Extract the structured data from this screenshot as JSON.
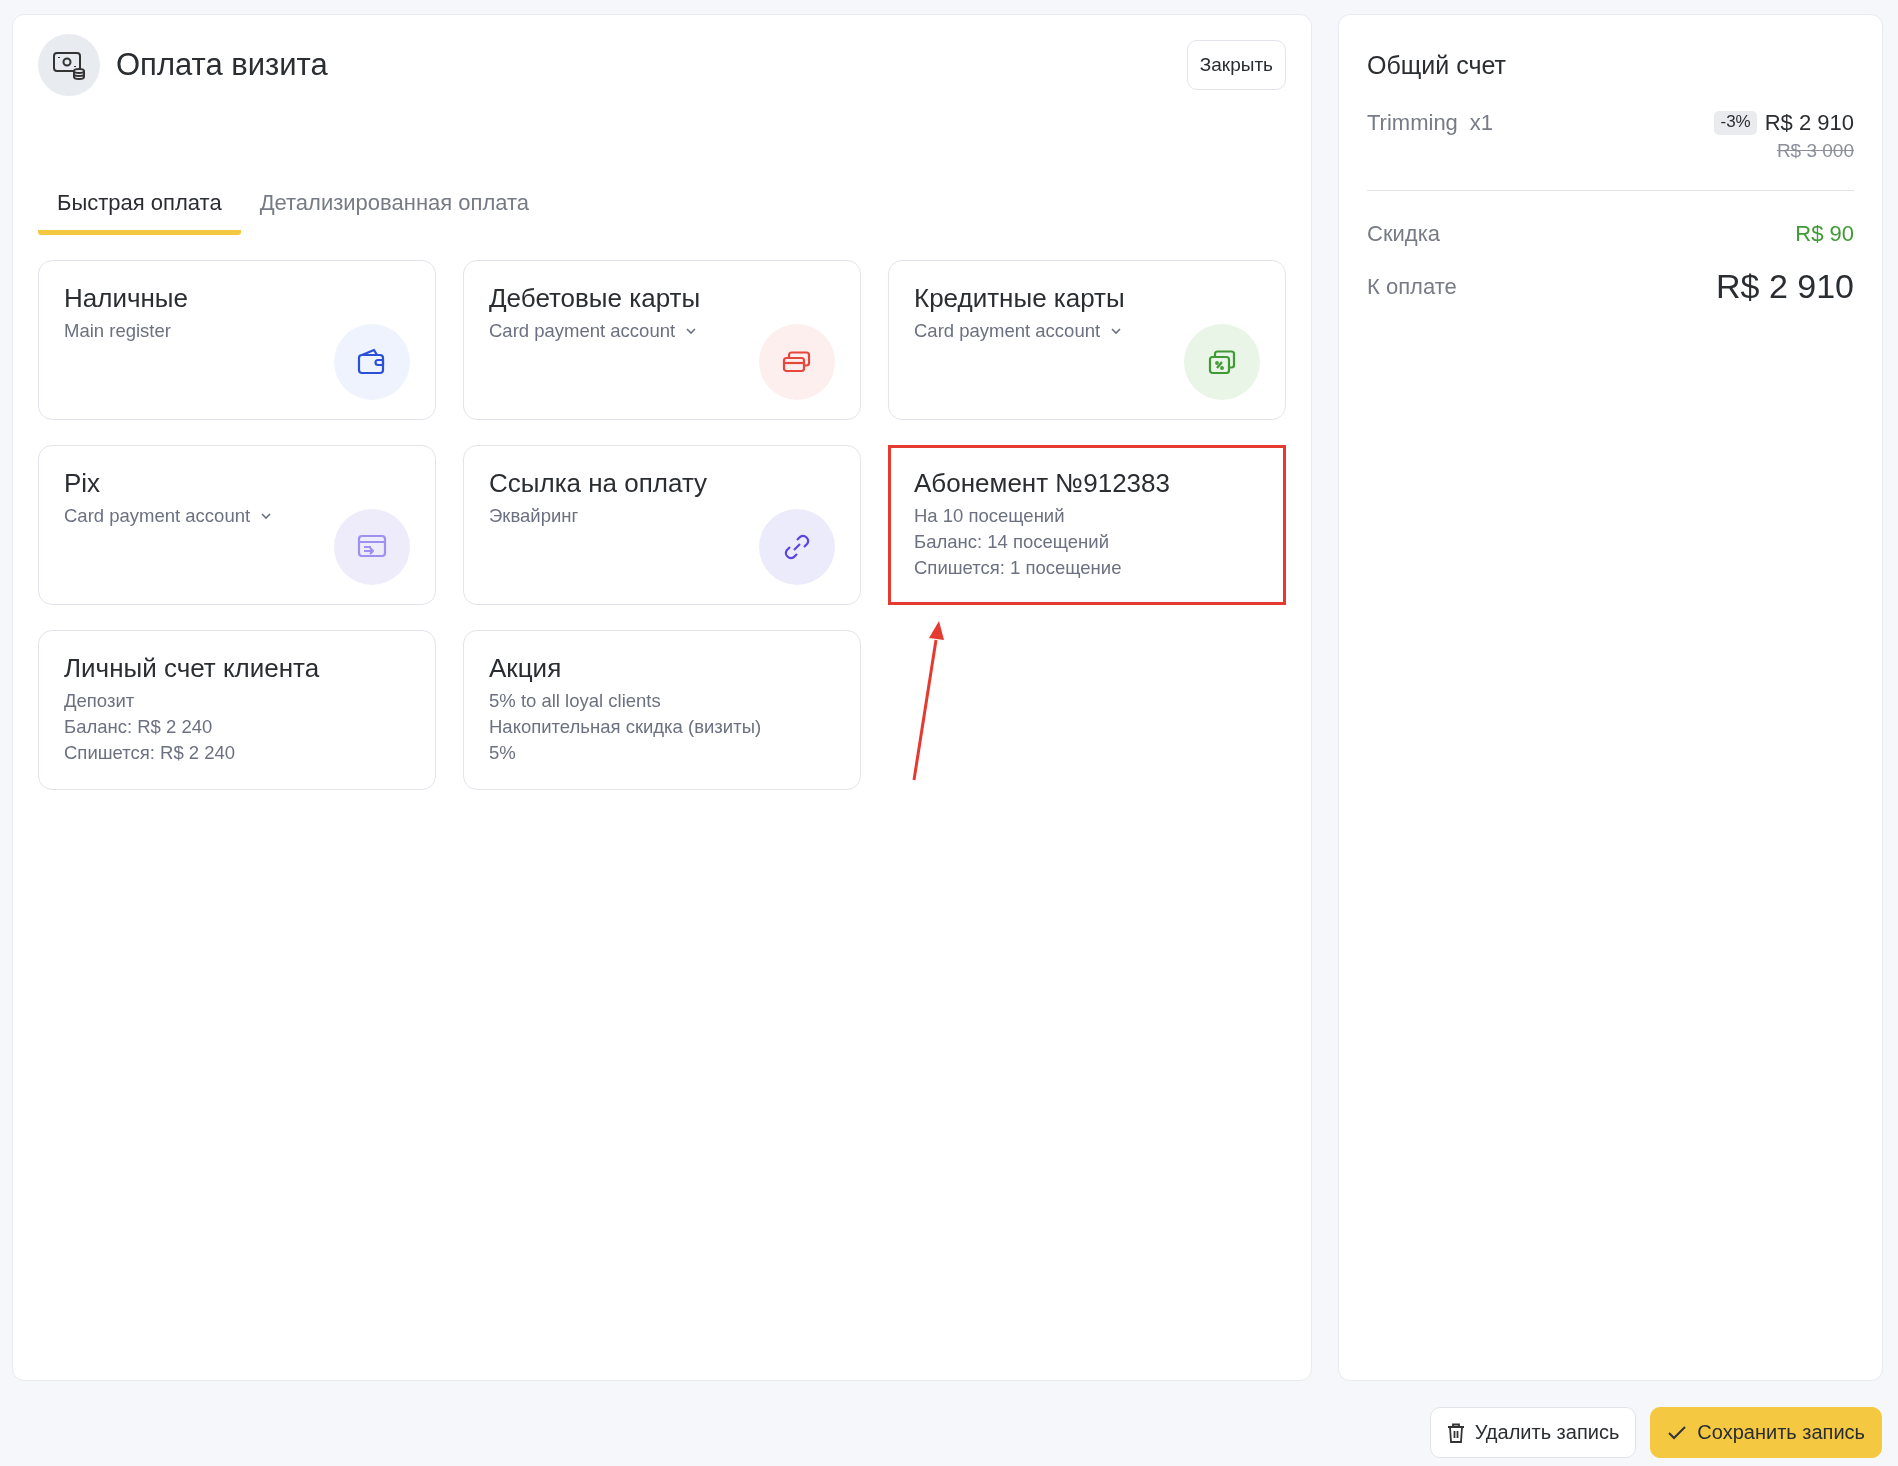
{
  "header": {
    "title": "Оплата визита",
    "close_button": "Закрыть"
  },
  "tabs": [
    {
      "label": "Быстрая оплата",
      "selected": true
    },
    {
      "label": "Детализированная оплата",
      "selected": false
    }
  ],
  "payment_methods": [
    {
      "title": "Наличные",
      "lines": [
        "Main register"
      ],
      "dropdown": false,
      "kind": "wallet",
      "highlighted": false
    },
    {
      "title": "Дебетовые карты",
      "lines": [
        "Card payment account"
      ],
      "dropdown": true,
      "kind": "cards",
      "highlighted": false
    },
    {
      "title": "Кредитные карты",
      "lines": [
        "Card payment account"
      ],
      "dropdown": true,
      "kind": "cards-percent",
      "highlighted": false
    },
    {
      "title": "Pix",
      "lines": [
        "Card payment account"
      ],
      "dropdown": true,
      "kind": "transfer",
      "highlighted": false
    },
    {
      "title": "Ссылка на оплату",
      "lines": [
        "Эквайринг"
      ],
      "dropdown": false,
      "kind": "link",
      "highlighted": false
    },
    {
      "title": "Абонемент №912383",
      "lines": [
        "На 10 посещений",
        "Баланс: 14 посещений",
        "Спишется: 1 посещение"
      ],
      "dropdown": false,
      "kind": "text",
      "highlighted": true
    },
    {
      "title": "Личный счет клиента",
      "lines": [
        "Депозит",
        "Баланс: R$ 2 240",
        "Спишется: R$ 2 240"
      ],
      "dropdown": false,
      "kind": "text",
      "highlighted": false
    },
    {
      "title": "Акция",
      "lines": [
        "5% to all loyal clients",
        "Накопительная скидка (визиты)",
        "5%"
      ],
      "dropdown": false,
      "kind": "text",
      "highlighted": false
    }
  ],
  "summary": {
    "title": "Общий счет",
    "items": [
      {
        "name": "Trimming",
        "qty": "x1",
        "discount_badge": "-3%",
        "price": "R$ 2 910",
        "old_price": "R$ 3 000"
      }
    ],
    "discount": {
      "label": "Скидка",
      "value": "R$ 90"
    },
    "total": {
      "label": "К оплате",
      "value": "R$ 2 910"
    }
  },
  "actions": {
    "delete": "Удалить запись",
    "save": "Сохранить запись"
  }
}
